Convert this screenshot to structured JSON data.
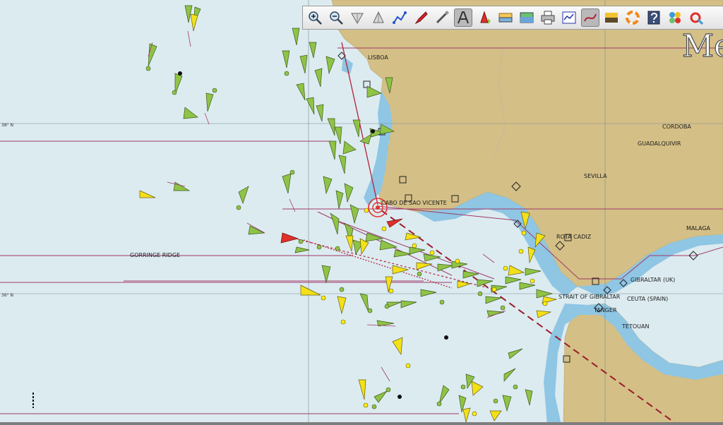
{
  "map": {
    "region_title": "Me",
    "latitude_labels": [
      "38° N",
      "36° N"
    ],
    "place_labels": {
      "lisboa": "LISBOA",
      "cordoba": "CORDOBA",
      "guadalquivir": "GUADALQUIVIR",
      "sevilla": "SEVILLA",
      "malaga": "MALAGA",
      "cabo": "CABO DE SAO VICENTE",
      "gorringe": "GORRINGE RIDGE",
      "strait": "STRAIT OF GIBRALTAR",
      "gibraltar": "GIBRALTAR (UK)",
      "ceuta": "CEUTA (SPAIN)",
      "tanger": "TANGER",
      "tetouan": "TETOUAN",
      "cadiz": "ROTA CADIZ"
    },
    "colors": {
      "sea": "#dcebf0",
      "shallow": "#8ec6e4",
      "land": "#d4bf86",
      "route": "#b22038",
      "vessel_green": "#8fc346",
      "vessel_yellow": "#f3e018",
      "vessel_red": "#e0302a"
    }
  },
  "toolbar": {
    "buttons": [
      {
        "name": "zoom-in",
        "icon": "zoom-in-icon",
        "active": false
      },
      {
        "name": "zoom-out",
        "icon": "zoom-out-icon",
        "active": false
      },
      {
        "name": "north-up",
        "icon": "north-up-icon",
        "active": false
      },
      {
        "name": "course-up",
        "icon": "course-up-icon",
        "active": false
      },
      {
        "name": "route",
        "icon": "route-icon",
        "active": false
      },
      {
        "name": "own-ship",
        "icon": "boat-icon",
        "active": false
      },
      {
        "name": "measure",
        "icon": "ruler-icon",
        "active": false
      },
      {
        "name": "text",
        "icon": "text-icon",
        "active": true
      },
      {
        "name": "ais",
        "icon": "ais-icon",
        "active": false
      },
      {
        "name": "layers",
        "icon": "layers-icon",
        "active": false
      },
      {
        "name": "chart",
        "icon": "chart-icon",
        "active": false
      },
      {
        "name": "print",
        "icon": "print-icon",
        "active": false
      },
      {
        "name": "dashboard",
        "icon": "dashboard-icon",
        "active": false
      },
      {
        "name": "track",
        "icon": "track-icon",
        "active": true
      },
      {
        "name": "color-scheme",
        "icon": "color-scheme-icon",
        "active": false
      },
      {
        "name": "mob",
        "icon": "lifebuoy-icon",
        "active": false
      },
      {
        "name": "help",
        "icon": "help-icon",
        "active": false
      },
      {
        "name": "plugins",
        "icon": "plugins-icon",
        "active": false
      },
      {
        "name": "alarm",
        "icon": "alarm-icon",
        "active": false
      }
    ]
  }
}
